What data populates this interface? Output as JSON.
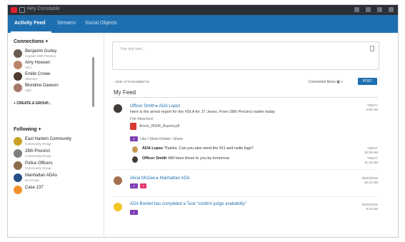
{
  "header": {
    "app_name": "Hey Constable"
  },
  "nav": {
    "tabs": [
      {
        "label": "Activity Feed"
      },
      {
        "label": "Streams"
      },
      {
        "label": "Social Objects"
      }
    ]
  },
  "sidebar": {
    "connections_title": "Connections +",
    "people": [
      {
        "name": "Benjamin Gurley",
        "sub": "Captain 28th Precinct"
      },
      {
        "name": "Amy Howsen",
        "sub": "ADA"
      },
      {
        "name": "Emilio Crowe",
        "sub": "Attorney"
      },
      {
        "name": "Blondine Dawson",
        "sub": "ADA"
      }
    ],
    "create_group": "+ CREATE A GROUP...",
    "following_title": "Following +",
    "groups": [
      {
        "name": "East Harlem Community",
        "sub": "Community Group",
        "color": "#c9a227"
      },
      {
        "name": "28th Precinct",
        "sub": "Community Group",
        "color": "#7d7d7d"
      },
      {
        "name": "Police Officers",
        "sub": "Community Group",
        "color": "#8a6d4a"
      },
      {
        "name": "Manhattan ADAs",
        "sub": "DA Group",
        "color": "#2a4f86"
      },
      {
        "name": "Case 137",
        "sub": "",
        "color": "#f0912f"
      }
    ]
  },
  "composer": {
    "placeholder": "Your text here..."
  },
  "tagging": {
    "add_tags": "ADD ATTACHMENTS",
    "connected_items": "Connected Items",
    "post_label": "POST"
  },
  "feed": {
    "title": "My Feed",
    "posts": [
      {
        "author": "Officer Smith",
        "target": "ADA Lopez",
        "text": "Here is the arrest report for the #DLA for JT Jones. From 28th Precinct earlier today",
        "file_label": "File Attached",
        "file_name": "Arrest_28346_Report.pdf",
        "actions": "Like / Show Details / Share",
        "badge": "1",
        "time": "TODAY",
        "time2": "2:00 AM",
        "replies": [
          {
            "author": "ADA Lopez",
            "text": "Thanks. Can you also send the 911 and radio logs?",
            "time": "TODAY",
            "time2": "10:38 AM"
          },
          {
            "author": "Officer Smith",
            "text": "Will have those to you by tomorrow.",
            "time": "TODAY",
            "time2": "11:15 AM"
          }
        ]
      },
      {
        "author": "Alicia McGee",
        "target": "Manhattan ADA",
        "badge": "2",
        "time": "05/22/2016",
        "time2": "10:41 AM"
      },
      {
        "author": "ADA Bonkel",
        "text": "has completed a Task \"confirm judge availability\"",
        "badge": "1",
        "time": "05/22/2016",
        "time2": "9:10 AM"
      }
    ]
  },
  "colors": {
    "nav_blue": "#1e6fb0",
    "header_dark": "#2c2f36",
    "accent_purple": "#7b3db3",
    "accent_pink": "#e2366d",
    "pdf_red": "#d63b2f"
  }
}
